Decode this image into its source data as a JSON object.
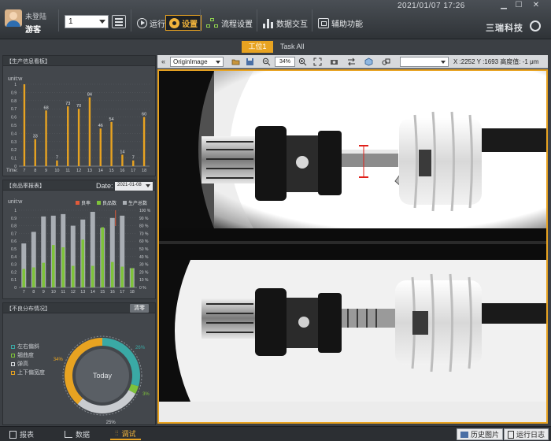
{
  "header": {
    "user_status": "未登陆",
    "user_name": "游客",
    "station_select_value": "1",
    "nav": {
      "run": "运行",
      "settings": "设置",
      "flow": "流程设置",
      "data_exchange": "数据交互",
      "aux": "辅助功能"
    },
    "datetime": "2021/01/07   17:26",
    "logo_text": "三瑞科技"
  },
  "tabs": [
    "工位1",
    "Task All"
  ],
  "production_panel": {
    "title": "【生产信息看板】",
    "unit": "unit:w",
    "xlabel": "Time:",
    "ytick_labels": [
      "1",
      "0.9",
      "0.8",
      "0.7",
      "0.6",
      "0.5",
      "0.4",
      "0.3",
      "0.2",
      "0.1",
      "0"
    ]
  },
  "yield_panel": {
    "title": "【良品率报表】",
    "date_label": "Date:",
    "date_value": "2021-01-08",
    "unit": "unit:w",
    "legend": [
      "良率",
      "良品数",
      "生产总数"
    ],
    "left_ticks": [
      "1",
      "0.9",
      "0.8",
      "0.7",
      "0.6",
      "0.5",
      "0.4",
      "0.3",
      "0.2",
      "0.1",
      "0"
    ],
    "right_ticks": [
      "100 %",
      "90 %",
      "80 %",
      "70 %",
      "60 %",
      "50 %",
      "40 %",
      "30 %",
      "20 %",
      "10 %",
      "0 %"
    ]
  },
  "distribution_panel": {
    "title": "【不良分布情况】",
    "clear_label": "清零",
    "center_label": "Today",
    "legend": [
      "左右偏斜",
      "翘曲度",
      "弹高",
      "上下偏宽度"
    ],
    "pct_labels": [
      "26%",
      "3%",
      "25%",
      "34%"
    ]
  },
  "viewer": {
    "image_select": "OriginImage",
    "zoom": "34%",
    "coords": "X :2252 Y :1693 高度值: -1 μm"
  },
  "bottom_nav": {
    "report": "报表",
    "data": "数据",
    "debug": "调试",
    "history_images": "历史图片",
    "run_log": "运行日志"
  },
  "colors": {
    "accent_orange": "#e8a321",
    "good_green": "#7ec23a",
    "total_gray": "#a9aeb4",
    "yield_red": "#e05a3a",
    "teal": "#3aa9a5"
  },
  "chart_data": [
    {
      "type": "bar",
      "title": "生产信息看板",
      "ylabel": "unit:w",
      "xlabel": "Time:",
      "ylim": [
        0,
        1
      ],
      "categories": [
        "7",
        "8",
        "9",
        "10",
        "11",
        "12",
        "13",
        "14",
        "15",
        "16",
        "17",
        "18"
      ],
      "values": [
        1.0,
        0.33,
        0.68,
        0.07,
        0.73,
        0.7,
        0.84,
        0.46,
        0.54,
        0.14,
        0.07,
        0.6
      ],
      "data_labels": [
        "",
        "33",
        "68",
        "7",
        "73",
        "70",
        "84",
        "46",
        "54",
        "14",
        "7",
        "60"
      ]
    },
    {
      "type": "bar",
      "title": "良品率报表",
      "ylabel": "unit:w",
      "ylim": [
        0,
        1
      ],
      "categories": [
        "7",
        "8",
        "9",
        "10",
        "11",
        "12",
        "13",
        "14",
        "15",
        "16",
        "17",
        "18"
      ],
      "series": [
        {
          "name": "生产总数",
          "values": [
            0.57,
            0.72,
            0.92,
            0.93,
            0.95,
            0.8,
            0.88,
            0.98,
            0.77,
            0.9,
            0.93,
            0.25
          ]
        },
        {
          "name": "良品数",
          "values": [
            0.24,
            0.26,
            0.32,
            0.55,
            0.52,
            0.28,
            0.62,
            0.28,
            0.78,
            0.33,
            0.27,
            0.25
          ]
        }
      ]
    },
    {
      "type": "pie",
      "title": "不良分布情况",
      "categories": [
        "左右偏斜",
        "翘曲度",
        "弹高",
        "上下偏宽度"
      ],
      "values": [
        26,
        3,
        25,
        34
      ]
    }
  ]
}
